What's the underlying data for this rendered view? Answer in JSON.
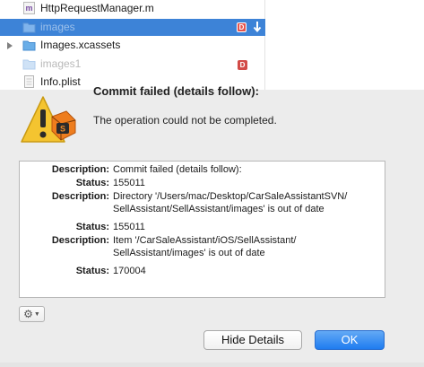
{
  "navigator": {
    "rows": [
      {
        "label": "HttpRequestManager.m",
        "icon": "m-source-file-icon"
      },
      {
        "label": "images",
        "icon": "folder-icon",
        "status_badge": "D",
        "selected": true
      },
      {
        "label": "Images.xcassets",
        "icon": "folder-icon",
        "expandable": true
      },
      {
        "label": "images1",
        "icon": "folder-icon",
        "status_badge": "D",
        "dimmed": true
      },
      {
        "label": "Info.plist",
        "icon": "plist-file-icon"
      }
    ]
  },
  "alert": {
    "title": "Commit failed (details follow):",
    "message": "The operation could not be completed.",
    "icon": "warning-icon",
    "details": {
      "line1_label": "Description:",
      "line1_value": "Commit failed (details follow):",
      "line2_label": "Status:",
      "line2_value": "155011",
      "line3_label": "Description:",
      "line3_value_a": "Directory '/Users/mac/Desktop/CarSaleAssistantSVN/",
      "line3_value_b": "SellAssistant/SellAssistant/images' is out of date",
      "line4_label": "Status:",
      "line4_value": "155011",
      "line5_label": "Description:",
      "line5_value_a": "Item '/CarSaleAssistant/iOS/SellAssistant/",
      "line5_value_b": "SellAssistant/images' is out of date",
      "line6_label": "Status:",
      "line6_value": "170004"
    },
    "buttons": {
      "hide_details": "Hide Details",
      "ok": "OK"
    }
  },
  "colors": {
    "selection": "#3d83d7",
    "badge_red": "#d24b47",
    "ok_button": "#1f7cf0",
    "sheet_background": "#ececec"
  }
}
